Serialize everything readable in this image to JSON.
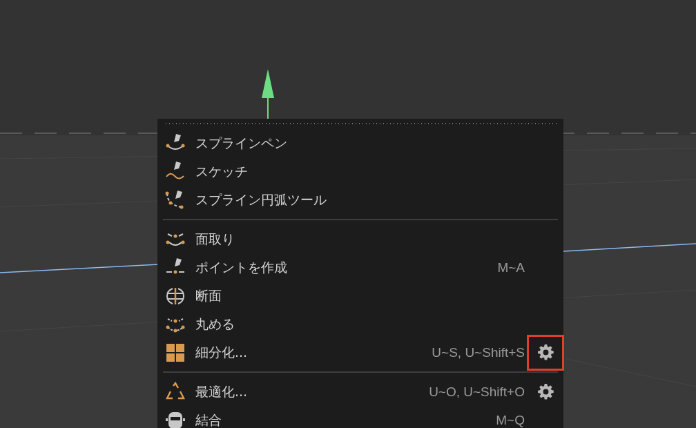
{
  "menu": {
    "groups": [
      {
        "items": [
          {
            "kind": "spline-pen",
            "label": "スプラインペン"
          },
          {
            "kind": "sketch",
            "label": "スケッチ"
          },
          {
            "kind": "spline-arc",
            "label": "スプライン円弧ツール"
          }
        ]
      },
      {
        "items": [
          {
            "kind": "chamfer",
            "label": "面取り"
          },
          {
            "kind": "create-point",
            "label": "ポイントを作成",
            "shortcut": "M~A"
          },
          {
            "kind": "section",
            "label": "断面"
          },
          {
            "kind": "round",
            "label": "丸める"
          },
          {
            "kind": "subdivide",
            "label": "細分化...",
            "shortcut": "U~S, U~Shift+S",
            "options": true,
            "highlighted": true
          }
        ]
      },
      {
        "items": [
          {
            "kind": "optimize",
            "label": "最適化...",
            "shortcut": "U~O, U~Shift+O",
            "options": true,
            "highlighted": false
          },
          {
            "kind": "join",
            "label": "結合",
            "shortcut": "M~Q"
          }
        ]
      }
    ]
  }
}
